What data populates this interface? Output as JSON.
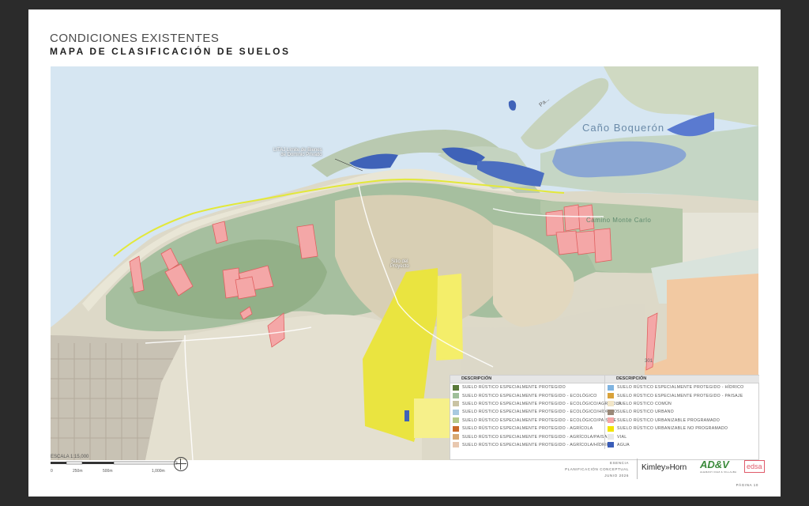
{
  "header": {
    "title": "CONDICIONES EXISTENTES",
    "subtitle": "MAPA DE CLASIFICACIÓN DE SUELOS"
  },
  "map": {
    "labels": {
      "bay": "Caño Boquerón",
      "community": "Camino Monte Carlo",
      "site": "Sitio del\nProyecto",
      "zmt": "LITAJ Límite de Bienes\nde Dominio Privado",
      "island": "Pa...",
      "road": "301"
    }
  },
  "legend": {
    "header_left": "DESCRIPCIÓN",
    "header_right": "DESCRIPCIÓN",
    "left": [
      {
        "label": "SUELO RÚSTICO ESPECIALMENTE PROTEGIDO",
        "color": "#5a7a3a"
      },
      {
        "label": "SUELO RÚSTICO ESPECIALMENTE PROTEGIDO - ECOLÓGICO",
        "color": "#9fbf9a"
      },
      {
        "label": "SUELO RÚSTICO ESPECIALMENTE PROTEGIDO - ECOLÓGICO/AGRÍCOLA",
        "color": "#c9c3a3"
      },
      {
        "label": "SUELO RÚSTICO ESPECIALMENTE PROTEGIDO - ECOLÓGICO/HÍDRICO",
        "color": "#a8c9e0"
      },
      {
        "label": "SUELO RÚSTICO ESPECIALMENTE PROTEGIDO - ECOLÓGICO/PAISAJE",
        "color": "#b5c98a"
      },
      {
        "label": "SUELO RÚSTICO ESPECIALMENTE PROTEGIDO - AGRÍCOLA",
        "color": "#c96a2a"
      },
      {
        "label": "SUELO RÚSTICO ESPECIALMENTE PROTEGIDO - AGRÍCOLA/PAISAJE",
        "color": "#d8a873"
      },
      {
        "label": "SUELO RÚSTICO ESPECIALMENTE PROTEGIDO - AGRÍCOLA/HÍDRICO",
        "color": "#e8c8b0"
      }
    ],
    "right": [
      {
        "label": "SUELO RÚSTICO ESPECIALMENTE PROTEGIDO - HÍDRICO",
        "color": "#7fb3e0"
      },
      {
        "label": "SUELO RÚSTICO ESPECIALMENTE PROTEGIDO - PAISAJE",
        "color": "#d9a23a"
      },
      {
        "label": "SUELO RÚSTICO COMÚN",
        "color": "#f2e6c8"
      },
      {
        "label": "SUELO RÚSTICO URBANO",
        "color": "#9a8878"
      },
      {
        "label": "SUELO RÚSTICO URBANIZABLE PROGRAMADO",
        "color": "#f4a7a7"
      },
      {
        "label": "SUELO RÚSTICO URBANIZABLE NO PROGRAMADO",
        "color": "#f2e400"
      },
      {
        "label": "VIAL",
        "color": "#e8e8e8"
      },
      {
        "label": "AGUA",
        "color": "#3a5db8"
      }
    ]
  },
  "scale": {
    "title": "ESCALA 1:15,000",
    "ticks": [
      "0",
      "250m",
      "500m",
      "1,000m"
    ]
  },
  "footer": {
    "project": "ESENCIA",
    "doc": "PLANIFICACIÓN CONCEPTUAL",
    "date": "JUNIO 2026",
    "logo1": "Kimley»Horn",
    "logo2": "AD&V",
    "logo2_sub": "ALEMANY DIAZ & VILLALBA",
    "logo3": "edsa",
    "page": "PÁGINA 10"
  }
}
